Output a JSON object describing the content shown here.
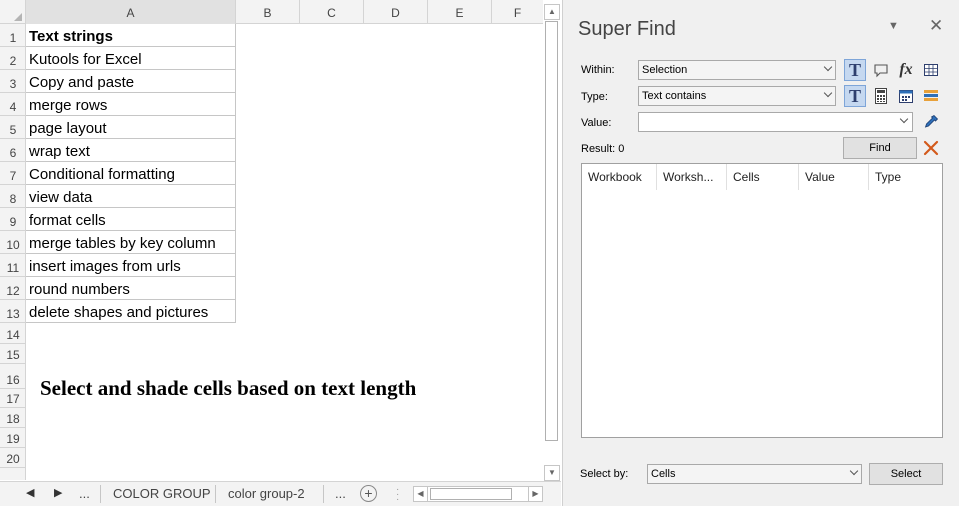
{
  "sheet": {
    "columns": [
      "A",
      "B",
      "C",
      "D",
      "E",
      "F"
    ],
    "selected_column": "A",
    "row_numbers": [
      "1",
      "2",
      "3",
      "4",
      "5",
      "6",
      "7",
      "8",
      "9",
      "10",
      "11",
      "12",
      "13",
      "14",
      "15",
      "16",
      "17",
      "18",
      "19",
      "20"
    ],
    "cells_a": [
      "Text strings",
      "Kutools for Excel",
      "Copy and paste",
      "merge rows",
      "page layout",
      "wrap text",
      "Conditional formatting",
      "view data",
      "format cells",
      "merge tables by key column",
      "insert images from urls",
      "round numbers",
      "delete shapes and pictures"
    ],
    "banner": "Select and shade cells based on text length"
  },
  "tabs": {
    "nav_prev": "◀",
    "nav_next": "▶",
    "ellipsis_left": "...",
    "ellipsis_right": "...",
    "items": [
      "COLOR GROUP",
      "color group-2"
    ],
    "add": "+"
  },
  "pane": {
    "title": "Super Find",
    "within_label": "Within:",
    "within_value": "Selection",
    "type_label": "Type:",
    "type_value": "Text contains",
    "value_label": "Value:",
    "value_text": "",
    "result_label": "Result: 0",
    "find_button": "Find",
    "result_columns": [
      "Workbook",
      "Worksh...",
      "Cells",
      "Value",
      "Type"
    ],
    "select_by_label": "Select by:",
    "select_by_value": "Cells",
    "select_button": "Select",
    "colors": {
      "active_tool": "#c5d8f0",
      "clear_icon": "#d35a1c"
    }
  }
}
